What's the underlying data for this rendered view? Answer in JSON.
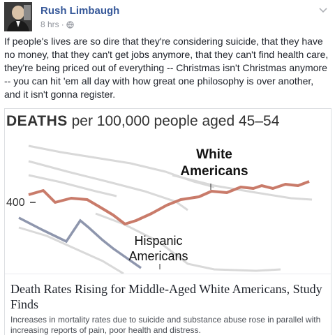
{
  "post": {
    "author": "Rush Limbaugh",
    "time": "8 hrs",
    "separator": "·",
    "text": "If people's lives are so dire that they're considering suicide, that they have no money, that they can't get jobs anymore, that they can't find health care, they're being priced out of everything -- Christmas isn't Christmas anymore -- you can hit 'em all day with how great one philosophy is over another, and it isn't gonna register."
  },
  "icons": {
    "privacy": "globe-icon",
    "menu": "chevron-down-icon"
  },
  "link": {
    "headline": "Death Rates Rising for Middle-Aged White Americans, Study Finds",
    "description": "Increases in mortality rates due to suicide and substance abuse rose in parallel with increasing reports of pain, poor health and distress."
  },
  "chart_data": {
    "type": "line",
    "title": "DEATHS",
    "subtitle": "per 100,000 people aged 45–54",
    "ytick_label": "400",
    "series": [
      {
        "name": "White Americans",
        "name_line1": "White",
        "name_line2": "Americans",
        "color": "#c97b6a"
      },
      {
        "name": "Hispanic Americans",
        "name_line1": "Hispanic",
        "name_line2": "Americans",
        "color": "#8e96ad"
      }
    ],
    "colors": {
      "highlight": "#c97b6a",
      "hispanic": "#8e96ad",
      "other": "#d9d9d9",
      "text": "#333333"
    }
  }
}
